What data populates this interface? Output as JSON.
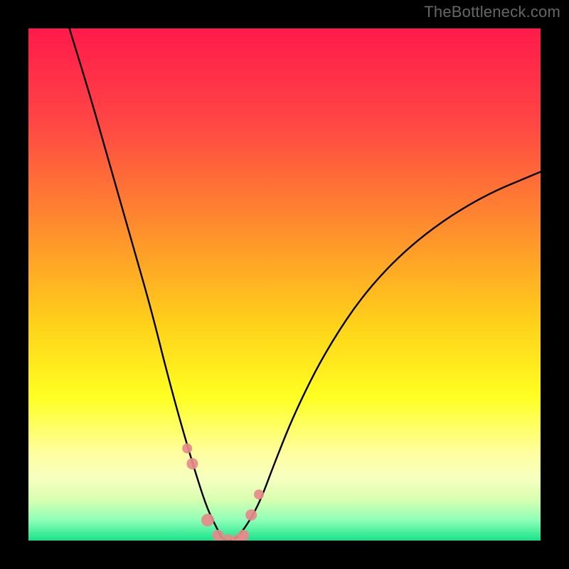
{
  "watermark": "TheBottleneck.com",
  "chart_data": {
    "type": "line",
    "title": "",
    "xlabel": "",
    "ylabel": "",
    "xlim": [
      0,
      100
    ],
    "ylim": [
      0,
      100
    ],
    "legend": false,
    "grid": false,
    "background_gradient_stops": [
      {
        "offset": 0.0,
        "color": "#ff1a4b"
      },
      {
        "offset": 0.18,
        "color": "#ff4545"
      },
      {
        "offset": 0.38,
        "color": "#ff8a2e"
      },
      {
        "offset": 0.58,
        "color": "#ffd21a"
      },
      {
        "offset": 0.72,
        "color": "#ffff22"
      },
      {
        "offset": 0.83,
        "color": "#ffffa0"
      },
      {
        "offset": 0.88,
        "color": "#f6ffc0"
      },
      {
        "offset": 0.92,
        "color": "#d8ffb0"
      },
      {
        "offset": 0.96,
        "color": "#8effb8"
      },
      {
        "offset": 1.0,
        "color": "#17e38a"
      }
    ],
    "series": [
      {
        "name": "bottleneck-curve",
        "color": "#000000",
        "x": [
          8,
          12,
          16,
          20,
          24,
          27,
          30,
          33,
          35,
          37,
          38,
          40,
          42,
          45,
          48,
          52,
          58,
          66,
          76,
          88,
          100
        ],
        "values": [
          100,
          87,
          73,
          59,
          45,
          33,
          22,
          12,
          6,
          2,
          0,
          0,
          2,
          7,
          15,
          25,
          37,
          49,
          59,
          67,
          72
        ]
      }
    ],
    "marker_series": {
      "name": "highlight-points",
      "color": "#e68a8a",
      "x": [
        31,
        32,
        35,
        37,
        39,
        41,
        42,
        43.5,
        45
      ],
      "values": [
        18,
        15,
        4,
        1,
        0,
        0,
        1,
        5,
        9
      ],
      "sizes": [
        14,
        16,
        18,
        16,
        18,
        18,
        16,
        16,
        14
      ]
    }
  }
}
